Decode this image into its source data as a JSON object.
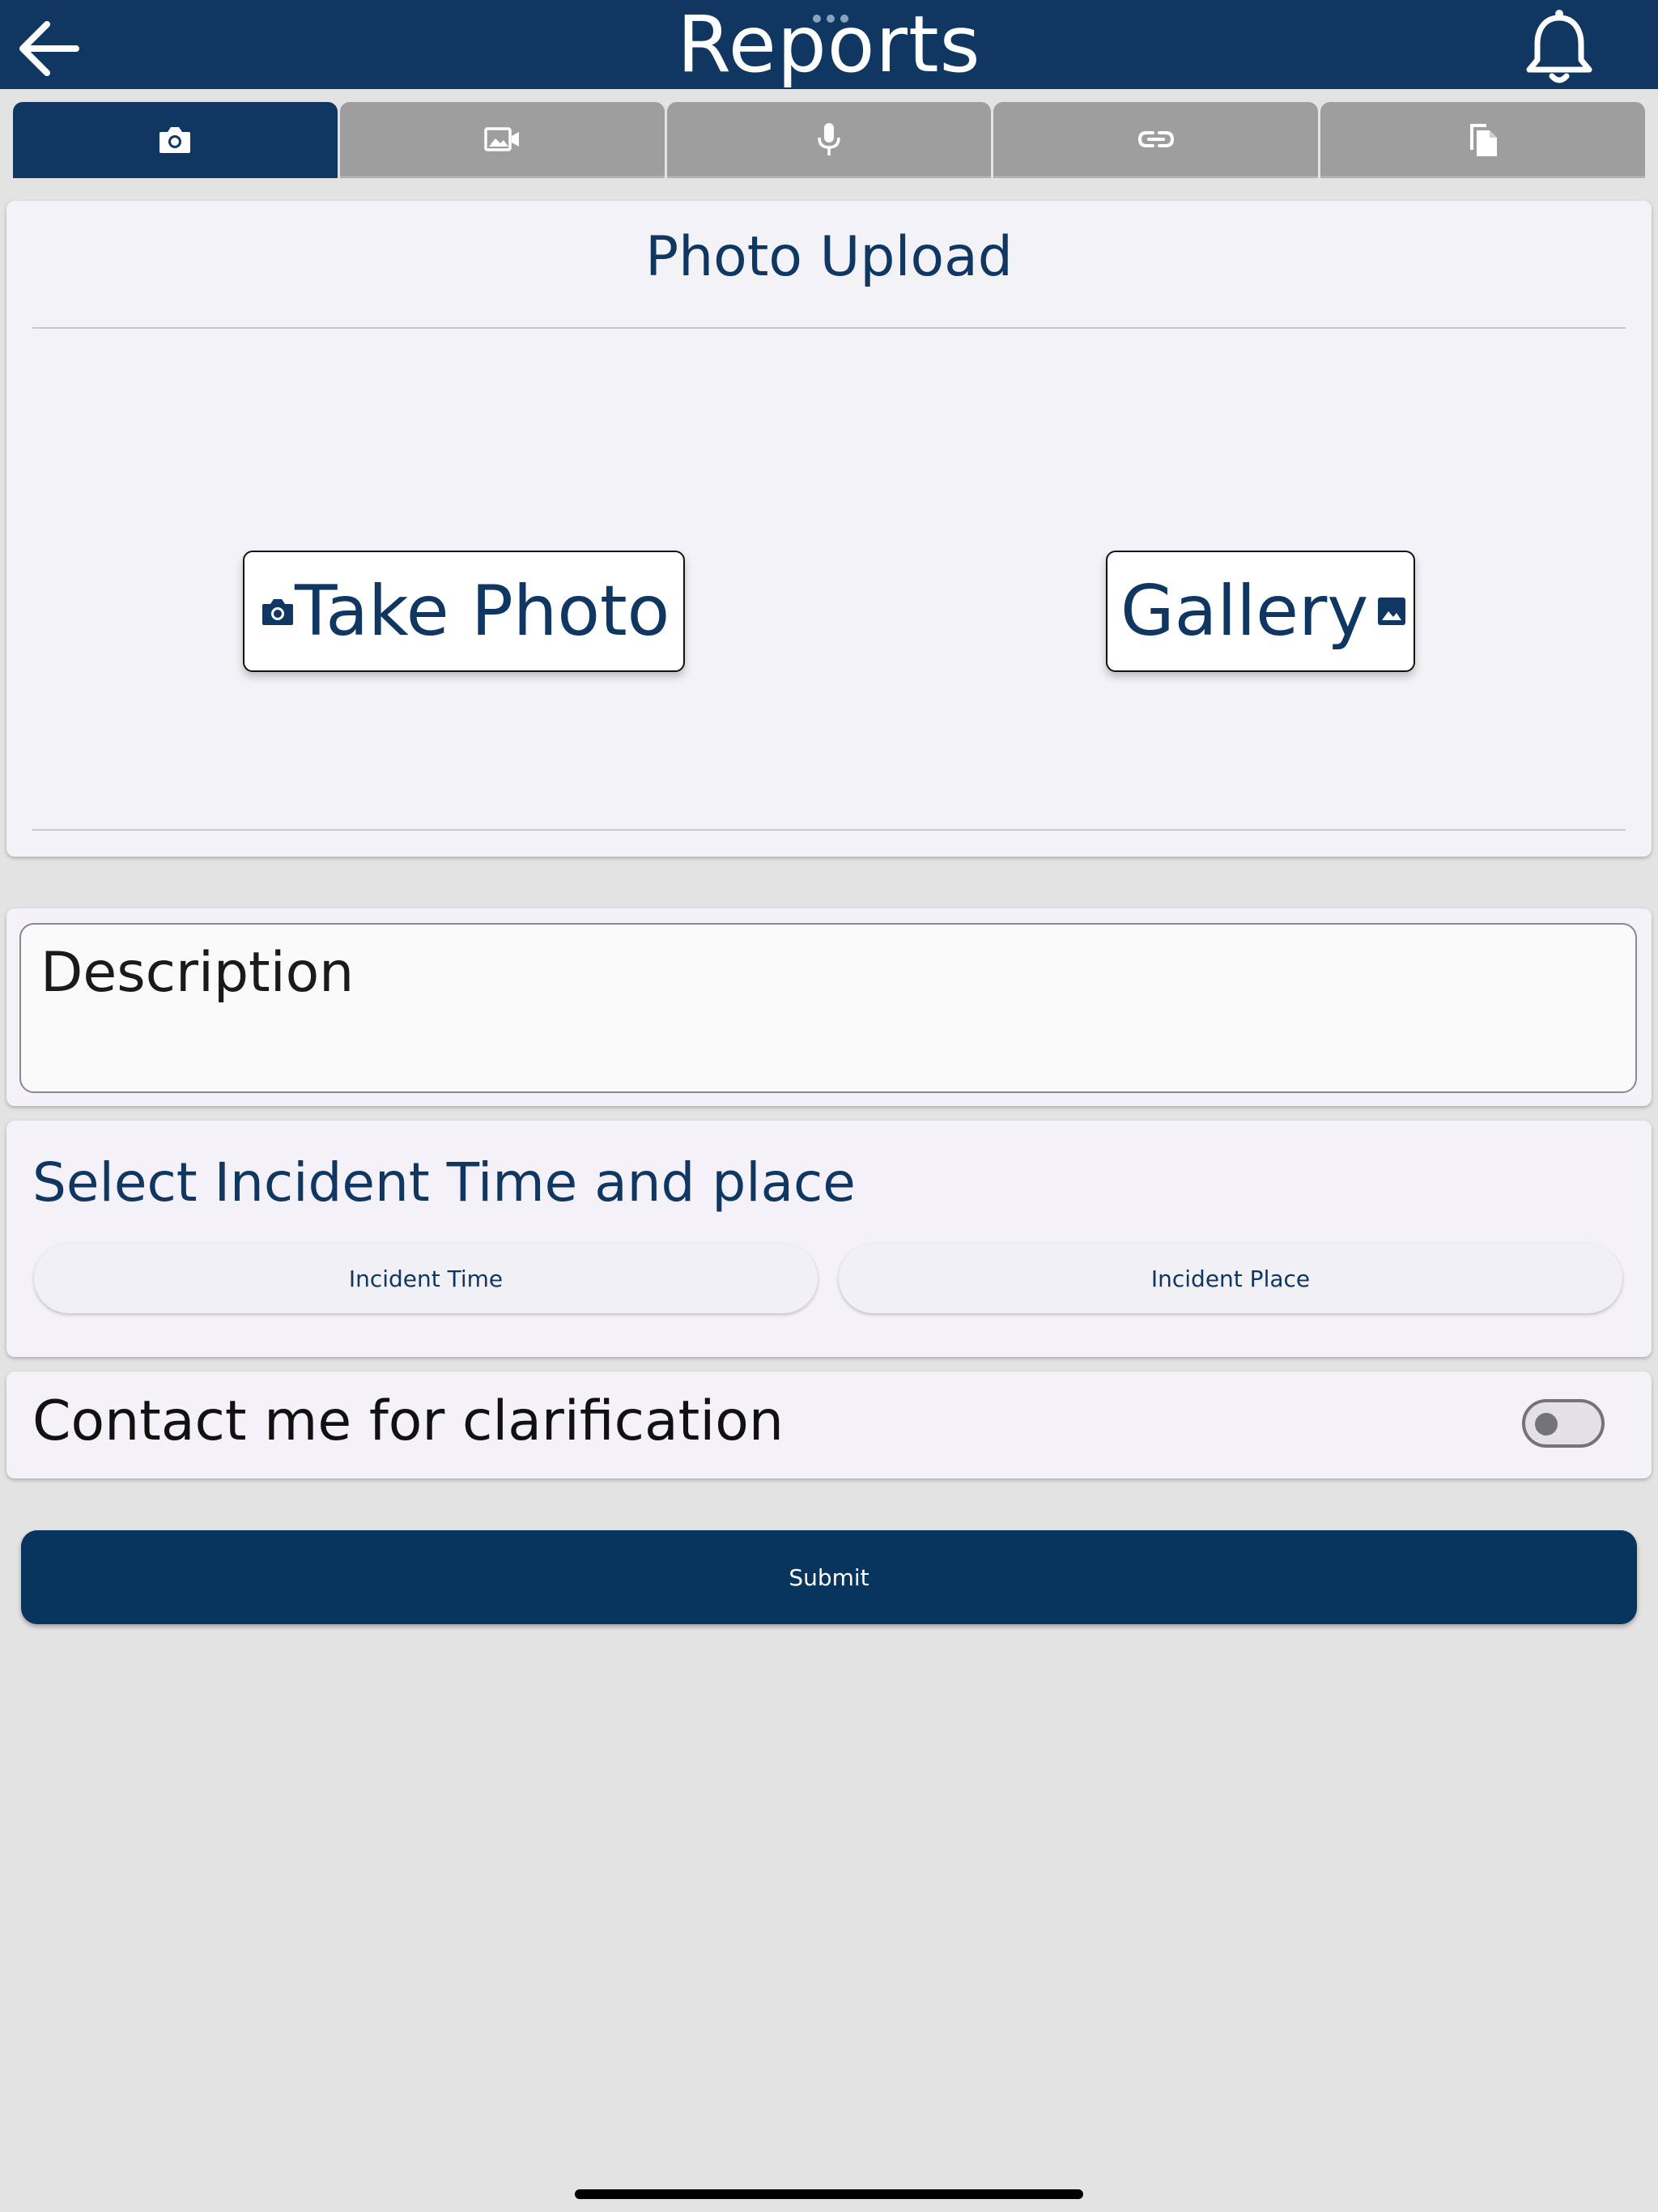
{
  "header": {
    "title": "Reports",
    "back_icon": "arrow-left-icon",
    "bell_icon": "bell-icon"
  },
  "tabs": [
    {
      "icon": "camera-icon",
      "active": true
    },
    {
      "icon": "video-icon",
      "active": false
    },
    {
      "icon": "microphone-icon",
      "active": false
    },
    {
      "icon": "link-icon",
      "active": false
    },
    {
      "icon": "document-icon",
      "active": false
    }
  ],
  "photo_upload": {
    "title": "Photo Upload",
    "take_photo_label": "Take Photo",
    "gallery_label": "Gallery"
  },
  "description": {
    "placeholder": "Description"
  },
  "incident": {
    "title": "Select Incident Time and place",
    "time_label": "Incident Time",
    "place_label": "Incident Place"
  },
  "contact": {
    "label": "Contact me for clarification",
    "enabled": false
  },
  "submit": {
    "label": "Submit"
  },
  "colors": {
    "primary": "#0f3762",
    "tab_inactive": "#9e9e9e",
    "background": "#e3e3e3"
  }
}
